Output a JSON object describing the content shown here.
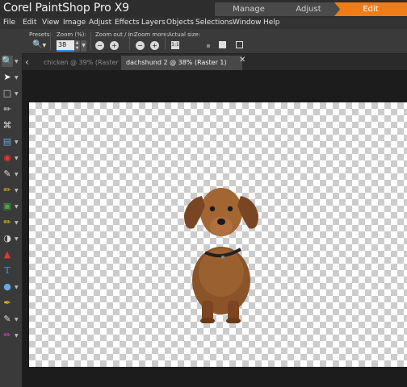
{
  "app": {
    "title": "Corel PaintShop Pro X9"
  },
  "workspace_tabs": [
    {
      "label": "Manage",
      "active": false
    },
    {
      "label": "Adjust",
      "active": false
    },
    {
      "label": "Edit",
      "active": true
    }
  ],
  "menu": [
    "File",
    "Edit",
    "View",
    "Image",
    "Adjust",
    "Effects",
    "Layers",
    "Objects",
    "Selections",
    "Window",
    "Help"
  ],
  "tool_options": {
    "presets_label": "Presets:",
    "zoom_label": "Zoom (%):",
    "zoom_value": "38",
    "zoom_out_in_label": "Zoom out / in:",
    "zoom_more_label": "Zoom more:",
    "actual_size_label": "Actual size:"
  },
  "document_tabs": [
    {
      "label": "chicken @  39% (Raster 1)",
      "active": false
    },
    {
      "label": "dachshund 2 @  38% (Raster 1)",
      "active": true
    }
  ],
  "colors": {
    "accent": "#f07c17",
    "canvas_check": "#cccccc"
  }
}
